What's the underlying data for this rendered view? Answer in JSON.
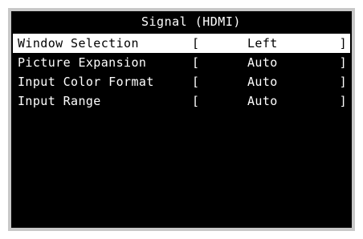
{
  "osd": {
    "title": "Signal (HDMI)",
    "items": [
      {
        "label": "Window Selection",
        "open": "[",
        "value": "Left",
        "close": "]",
        "selected": true
      },
      {
        "label": "Picture Expansion",
        "open": "[",
        "value": "Auto",
        "close": "]",
        "selected": false
      },
      {
        "label": "Input Color Format",
        "open": "[",
        "value": "Auto",
        "close": "]",
        "selected": false
      },
      {
        "label": "Input Range",
        "open": "[",
        "value": "Auto",
        "close": "]",
        "selected": false
      }
    ]
  },
  "colors": {
    "background": "#000000",
    "text": "#ffffff",
    "highlight": "#ffffff",
    "highlight_text": "#000000",
    "frame": "#c8c8c8"
  }
}
